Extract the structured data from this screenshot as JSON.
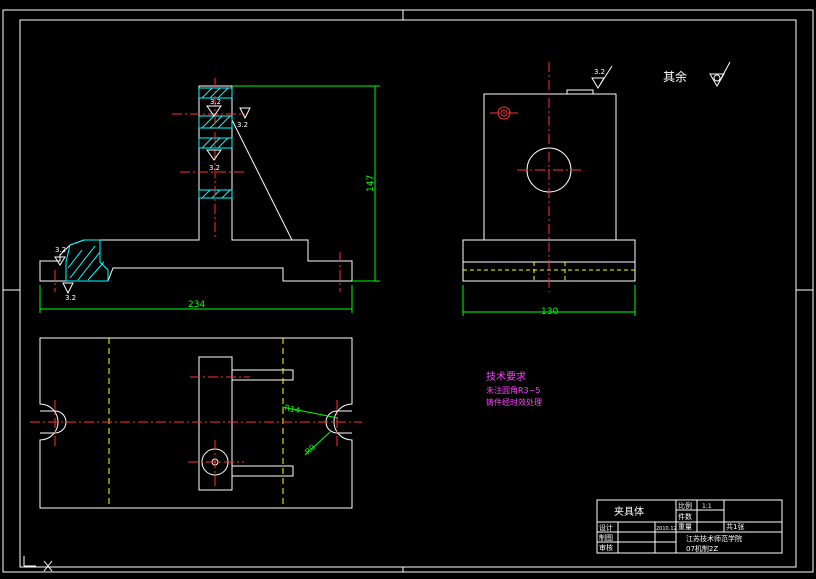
{
  "drawing": {
    "dimensions": {
      "base_length": "234",
      "height": "147",
      "side_width": "130",
      "radius_large": "R14",
      "radius_small": "R9"
    },
    "roughness": {
      "value": "3.2",
      "other_label": "其余"
    },
    "tech_req": {
      "title": "技术要求",
      "line1": "未注圆角R3~5",
      "line2": "铸件经时效处理"
    },
    "title_block": {
      "part_name": "夹具体",
      "scale_label": "比例",
      "scale_value": "1:1",
      "count_label": "件数",
      "weight_label": "重量",
      "sheet_label": "共1张",
      "design_label": "设计",
      "design_date": "2010.12",
      "draw_label": "制图",
      "review_label": "审核",
      "school": "江苏技术师范学院",
      "class_name": "07机制2Z"
    },
    "colors": {
      "outline": "#ffffff",
      "center": "#ff3030",
      "hidden": "#ffff00",
      "dimension": "#00ff00",
      "hatch": "#00ffff",
      "text_tech": "#ff40ff"
    }
  }
}
